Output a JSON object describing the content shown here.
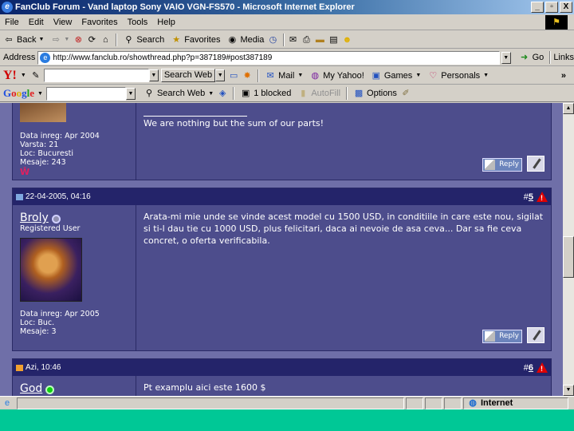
{
  "window": {
    "title": "FanClub Forum - Vand laptop Sony VAIO VGN-FS570 - Microsoft Internet Explorer",
    "controls": [
      "_",
      "̸",
      "X"
    ]
  },
  "menu": [
    "File",
    "Edit",
    "View",
    "Favorites",
    "Tools",
    "Help"
  ],
  "toolbar": {
    "back": "Back",
    "search": "Search",
    "favorites": "Favorites",
    "media": "Media"
  },
  "address": {
    "label": "Address",
    "url": "http://www.fanclub.ro/showthread.php?p=387189#post387189",
    "go": "Go",
    "links": "Links"
  },
  "yahoo": {
    "search_button": "Search Web",
    "mail": "Mail",
    "my_yahoo": "My Yahoo!",
    "games": "Games",
    "personals": "Personals"
  },
  "google": {
    "search_button": "Search Web",
    "blocked": "1 blocked",
    "autofill": "AutoFill",
    "options": "Options"
  },
  "posts": [
    {
      "author_info": {
        "joined": "Data inreg: Apr 2004",
        "age": "Varsta: 21",
        "location": "Loc: Bucuresti",
        "messages": "Mesaje: 243"
      },
      "signature": "We are nothing but the sum of our parts!",
      "reply_label": "Reply"
    },
    {
      "date": "22-04-2005, 04:16",
      "number_prefix": "#",
      "number": "5",
      "author": "Broly",
      "role": "Registered User",
      "author_info": {
        "joined": "Data inreg: Apr 2005",
        "location": "Loc: Buc.",
        "messages": "Mesaje: 3"
      },
      "text": "Arata-mi mie unde se vinde acest model cu 1500 USD, in conditiile in care este nou, sigilat si ti-l dau tie cu 1000 USD, plus felicitari, daca ai nevoie de asa ceva... Dar sa fie ceva concret, o oferta verificabila.",
      "reply_label": "Reply"
    },
    {
      "date": "Azi, 10:46",
      "number_prefix": "#",
      "number": "6",
      "author": "God",
      "text": "Pt examplu aici este 1600 $"
    }
  ],
  "status": {
    "zone": "Internet"
  },
  "colors": {
    "title_bar": "#0a246a",
    "forum_bg": "#4d4d8c",
    "post_header": "#24246a",
    "online": "#10d010",
    "desktop": "#00c896"
  }
}
